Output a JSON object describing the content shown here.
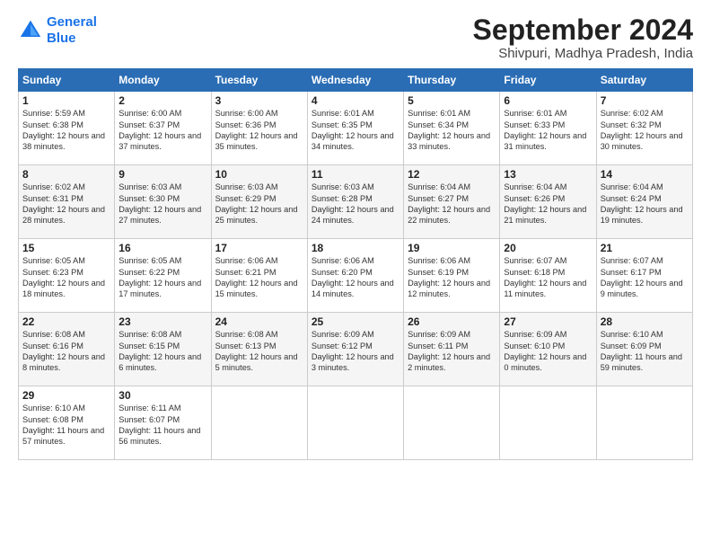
{
  "logo": {
    "line1": "General",
    "line2": "Blue"
  },
  "title": "September 2024",
  "subtitle": "Shivpuri, Madhya Pradesh, India",
  "header": {
    "days": [
      "Sunday",
      "Monday",
      "Tuesday",
      "Wednesday",
      "Thursday",
      "Friday",
      "Saturday"
    ]
  },
  "weeks": [
    [
      {
        "num": "1",
        "rise": "Sunrise: 5:59 AM",
        "set": "Sunset: 6:38 PM",
        "daylight": "Daylight: 12 hours and 38 minutes."
      },
      {
        "num": "2",
        "rise": "Sunrise: 6:00 AM",
        "set": "Sunset: 6:37 PM",
        "daylight": "Daylight: 12 hours and 37 minutes."
      },
      {
        "num": "3",
        "rise": "Sunrise: 6:00 AM",
        "set": "Sunset: 6:36 PM",
        "daylight": "Daylight: 12 hours and 35 minutes."
      },
      {
        "num": "4",
        "rise": "Sunrise: 6:01 AM",
        "set": "Sunset: 6:35 PM",
        "daylight": "Daylight: 12 hours and 34 minutes."
      },
      {
        "num": "5",
        "rise": "Sunrise: 6:01 AM",
        "set": "Sunset: 6:34 PM",
        "daylight": "Daylight: 12 hours and 33 minutes."
      },
      {
        "num": "6",
        "rise": "Sunrise: 6:01 AM",
        "set": "Sunset: 6:33 PM",
        "daylight": "Daylight: 12 hours and 31 minutes."
      },
      {
        "num": "7",
        "rise": "Sunrise: 6:02 AM",
        "set": "Sunset: 6:32 PM",
        "daylight": "Daylight: 12 hours and 30 minutes."
      }
    ],
    [
      {
        "num": "8",
        "rise": "Sunrise: 6:02 AM",
        "set": "Sunset: 6:31 PM",
        "daylight": "Daylight: 12 hours and 28 minutes."
      },
      {
        "num": "9",
        "rise": "Sunrise: 6:03 AM",
        "set": "Sunset: 6:30 PM",
        "daylight": "Daylight: 12 hours and 27 minutes."
      },
      {
        "num": "10",
        "rise": "Sunrise: 6:03 AM",
        "set": "Sunset: 6:29 PM",
        "daylight": "Daylight: 12 hours and 25 minutes."
      },
      {
        "num": "11",
        "rise": "Sunrise: 6:03 AM",
        "set": "Sunset: 6:28 PM",
        "daylight": "Daylight: 12 hours and 24 minutes."
      },
      {
        "num": "12",
        "rise": "Sunrise: 6:04 AM",
        "set": "Sunset: 6:27 PM",
        "daylight": "Daylight: 12 hours and 22 minutes."
      },
      {
        "num": "13",
        "rise": "Sunrise: 6:04 AM",
        "set": "Sunset: 6:26 PM",
        "daylight": "Daylight: 12 hours and 21 minutes."
      },
      {
        "num": "14",
        "rise": "Sunrise: 6:04 AM",
        "set": "Sunset: 6:24 PM",
        "daylight": "Daylight: 12 hours and 19 minutes."
      }
    ],
    [
      {
        "num": "15",
        "rise": "Sunrise: 6:05 AM",
        "set": "Sunset: 6:23 PM",
        "daylight": "Daylight: 12 hours and 18 minutes."
      },
      {
        "num": "16",
        "rise": "Sunrise: 6:05 AM",
        "set": "Sunset: 6:22 PM",
        "daylight": "Daylight: 12 hours and 17 minutes."
      },
      {
        "num": "17",
        "rise": "Sunrise: 6:06 AM",
        "set": "Sunset: 6:21 PM",
        "daylight": "Daylight: 12 hours and 15 minutes."
      },
      {
        "num": "18",
        "rise": "Sunrise: 6:06 AM",
        "set": "Sunset: 6:20 PM",
        "daylight": "Daylight: 12 hours and 14 minutes."
      },
      {
        "num": "19",
        "rise": "Sunrise: 6:06 AM",
        "set": "Sunset: 6:19 PM",
        "daylight": "Daylight: 12 hours and 12 minutes."
      },
      {
        "num": "20",
        "rise": "Sunrise: 6:07 AM",
        "set": "Sunset: 6:18 PM",
        "daylight": "Daylight: 12 hours and 11 minutes."
      },
      {
        "num": "21",
        "rise": "Sunrise: 6:07 AM",
        "set": "Sunset: 6:17 PM",
        "daylight": "Daylight: 12 hours and 9 minutes."
      }
    ],
    [
      {
        "num": "22",
        "rise": "Sunrise: 6:08 AM",
        "set": "Sunset: 6:16 PM",
        "daylight": "Daylight: 12 hours and 8 minutes."
      },
      {
        "num": "23",
        "rise": "Sunrise: 6:08 AM",
        "set": "Sunset: 6:15 PM",
        "daylight": "Daylight: 12 hours and 6 minutes."
      },
      {
        "num": "24",
        "rise": "Sunrise: 6:08 AM",
        "set": "Sunset: 6:13 PM",
        "daylight": "Daylight: 12 hours and 5 minutes."
      },
      {
        "num": "25",
        "rise": "Sunrise: 6:09 AM",
        "set": "Sunset: 6:12 PM",
        "daylight": "Daylight: 12 hours and 3 minutes."
      },
      {
        "num": "26",
        "rise": "Sunrise: 6:09 AM",
        "set": "Sunset: 6:11 PM",
        "daylight": "Daylight: 12 hours and 2 minutes."
      },
      {
        "num": "27",
        "rise": "Sunrise: 6:09 AM",
        "set": "Sunset: 6:10 PM",
        "daylight": "Daylight: 12 hours and 0 minutes."
      },
      {
        "num": "28",
        "rise": "Sunrise: 6:10 AM",
        "set": "Sunset: 6:09 PM",
        "daylight": "Daylight: 11 hours and 59 minutes."
      }
    ],
    [
      {
        "num": "29",
        "rise": "Sunrise: 6:10 AM",
        "set": "Sunset: 6:08 PM",
        "daylight": "Daylight: 11 hours and 57 minutes."
      },
      {
        "num": "30",
        "rise": "Sunrise: 6:11 AM",
        "set": "Sunset: 6:07 PM",
        "daylight": "Daylight: 11 hours and 56 minutes."
      },
      null,
      null,
      null,
      null,
      null
    ]
  ]
}
